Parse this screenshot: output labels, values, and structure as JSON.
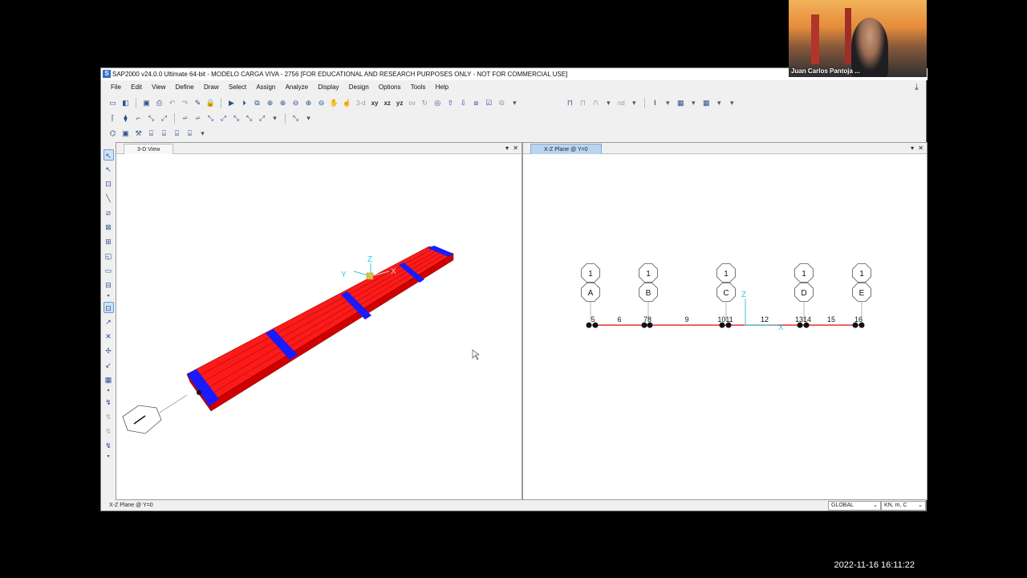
{
  "app": {
    "title": "SAP2000 v24.0.0 Ultimate 64-bit - MODELO CARGA VIVA - 2756  [FOR EDUCATIONAL AND RESEARCH PURPOSES ONLY - NOT FOR COMMERCIAL USE]",
    "icon_letter": "S",
    "accent": "#2f6fc7"
  },
  "menu": [
    "File",
    "Edit",
    "View",
    "Define",
    "Draw",
    "Select",
    "Assign",
    "Analyze",
    "Display",
    "Design",
    "Options",
    "Tools",
    "Help"
  ],
  "toolbar": {
    "view_3d": "3-d",
    "view_xy": "xy",
    "view_xz": "xz",
    "view_yz": "yz",
    "view_nv": "nv",
    "nd_label": "nd"
  },
  "panes": {
    "left_tab": "3-D View",
    "right_tab": "X-Z Plane @ Y=0",
    "close_symbol": "✕",
    "dropdown_symbol": "▾"
  },
  "view3d": {
    "axes": {
      "x": "X",
      "y": "Y",
      "z": "Z"
    },
    "member_color": "#ff1a1a",
    "section_color": "#1a1aff"
  },
  "elevation": {
    "grid_bubbles_top": [
      "1",
      "1",
      "1",
      "1",
      "1"
    ],
    "grid_bubbles_bottom": [
      "A",
      "B",
      "C",
      "D",
      "E"
    ],
    "labels": [
      "5",
      "6",
      "78",
      "9",
      "1011",
      "12",
      "1314",
      "15",
      "16"
    ],
    "axes": {
      "x": "X",
      "z": "Z"
    },
    "frame_color": "#e03030",
    "axis_color": "#33c8e0"
  },
  "status": {
    "left": "X-Z Plane @ Y=0",
    "coord_system": "GLOBAL",
    "units": "KN, m, C"
  },
  "webcam": {
    "name": "Juan Carlos Pantoja ..."
  },
  "timestamp": "2022-11-16  16:11:22"
}
